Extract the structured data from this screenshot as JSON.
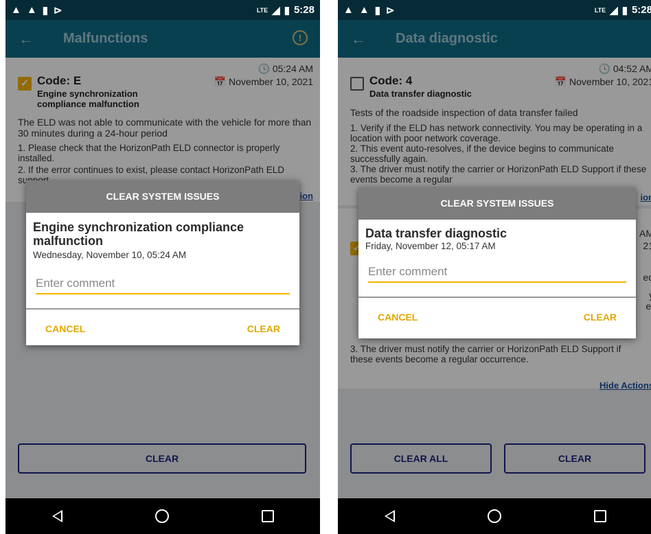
{
  "left": {
    "status_time": "5:28",
    "status_lte": "LTE",
    "title": "Malfunctions",
    "card": {
      "time": "🕓 05:24 AM",
      "date": "📅 November 10, 2021",
      "code": "Code: E",
      "subtitle": "Engine synchronization compliance malfunction",
      "description": "The ELD was not able to communicate with the vehicle for more than 30 minutes during a 24-hour period",
      "action1": "1. Please check that the HorizonPath ELD connector is properly installed.",
      "action2": "2. If the error continues to exist, please contact HorizonPath ELD support.",
      "link_partial": "ion"
    },
    "dialog": {
      "header": "CLEAR SYSTEM ISSUES",
      "title": "Engine synchronization compliance malfunction",
      "date": "Wednesday, November 10, 05:24 AM",
      "placeholder": "Enter comment",
      "cancel": "CANCEL",
      "clear": "CLEAR"
    },
    "bottom_clear": "CLEAR"
  },
  "right": {
    "status_time": "5:28",
    "status_lte": "LTE",
    "title": "Data diagnostic",
    "card": {
      "time": "🕓 04:52 AM",
      "date": "📅 November 10, 2021",
      "code": "Code: 4",
      "subtitle": "Data transfer diagnostic",
      "description": "Tests of the roadside inspection of data transfer failed",
      "action1": "1. Verify if the ELD has network connectivity. You may be operating in a location with poor network coverage.",
      "action2": "2. This event auto-resolves, if the device begins to communicate successfully again.",
      "action3": "3. The driver must notify the carrier or HorizonPath ELD Support if these events become a regular",
      "link_partial": "ion"
    },
    "card2": {
      "partial_time": "AM",
      "partial_date": "21",
      "partial_1": "ed",
      "partial_2": "y",
      "partial_3": "e.",
      "action3": "3. The driver must notify the carrier or HorizonPath ELD Support if these events become a regular occurrence.",
      "hide_actions": "Hide Actions"
    },
    "dialog": {
      "header": "CLEAR SYSTEM ISSUES",
      "title": "Data transfer diagnostic",
      "date": "Friday, November 12, 05:17 AM",
      "placeholder": "Enter comment",
      "cancel": "CANCEL",
      "clear": "CLEAR"
    },
    "bottom_clear_all": "CLEAR ALL",
    "bottom_clear": "CLEAR"
  }
}
